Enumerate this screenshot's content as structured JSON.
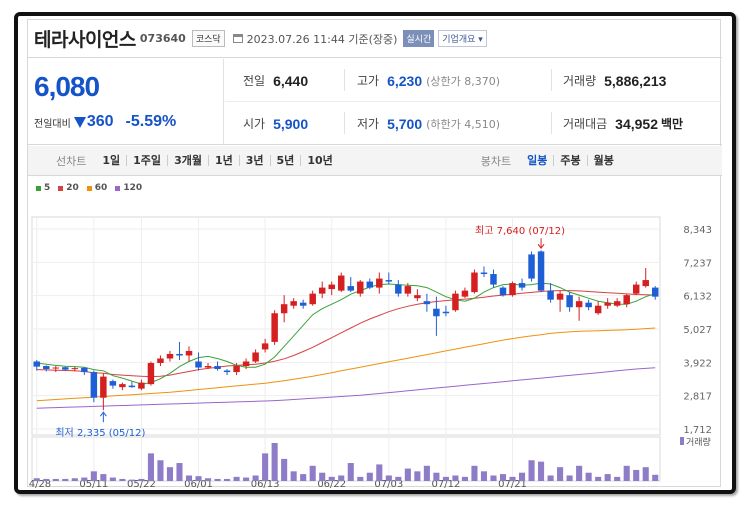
{
  "header": {
    "name": "테라사이언스",
    "code": "073640",
    "market": "코스닥",
    "datetime": "2023.07.26 11:44 기준(장중)",
    "realtime_label": "실시간",
    "corp_label": "기업개요"
  },
  "summary": {
    "price": "6,080",
    "change_label": "전일대비",
    "change_amount": "360",
    "change_pct": "-5.59%",
    "prev_close_label": "전일",
    "prev_close": "6,440",
    "high_label": "고가",
    "high": "6,230",
    "upper_limit_label": "(상한가 8,370)",
    "volume_label": "거래량",
    "volume": "5,886,213",
    "open_label": "시가",
    "open": "5,900",
    "low_label": "저가",
    "low": "5,700",
    "lower_limit_label": "(하한가 4,510)",
    "amount_label": "거래대금",
    "amount": "34,952",
    "amount_unit": "백만"
  },
  "line_chart": {
    "label": "선차트",
    "periods": [
      "1일",
      "1주일",
      "3개월",
      "1년",
      "3년",
      "5년",
      "10년"
    ]
  },
  "candle_chart": {
    "label": "봉차트",
    "periods": [
      "일봉",
      "주봉",
      "월봉"
    ],
    "active": "일봉"
  },
  "colors": {
    "up": "#d42020",
    "down": "#1f5fd6",
    "ma5": "#3aa13a",
    "ma20": "#d94040",
    "ma60": "#f0900f",
    "ma120": "#9966cc",
    "volume": "#8e7cc8"
  },
  "chart_data": {
    "type": "candlestick",
    "legend": [
      {
        "name": "5",
        "color": "#3aa13a"
      },
      {
        "name": "20",
        "color": "#d94040"
      },
      {
        "name": "60",
        "color": "#f0900f"
      },
      {
        "name": "120",
        "color": "#9966cc"
      }
    ],
    "y_ticks": [
      "8,343",
      "7,237",
      "6,132",
      "5,027",
      "3,922",
      "2,817",
      "1,712"
    ],
    "ylim": [
      1712,
      8343
    ],
    "x_ticks": [
      "04/28",
      "05/11",
      "05/22",
      "06/01",
      "06/13",
      "06/22",
      "07/03",
      "07/12",
      "07/21"
    ],
    "x_tick_index": [
      0,
      6,
      11,
      17,
      24,
      31,
      37,
      43,
      50
    ],
    "high_annotation": "최고 7,640 (07/12)",
    "low_annotation": "최저 2,335 (05/12)",
    "volume_label": "거래량",
    "candles": [
      [
        3950,
        4000,
        3650,
        3780
      ],
      [
        3800,
        3820,
        3620,
        3700
      ],
      [
        3720,
        3800,
        3600,
        3750
      ],
      [
        3760,
        3780,
        3650,
        3680
      ],
      [
        3700,
        3780,
        3620,
        3730
      ],
      [
        3740,
        3760,
        3500,
        3600
      ],
      [
        3600,
        3650,
        2600,
        2750
      ],
      [
        2750,
        3550,
        2335,
        3450
      ],
      [
        3300,
        3350,
        3050,
        3150
      ],
      [
        3100,
        3250,
        3000,
        3200
      ],
      [
        3150,
        3280,
        3080,
        3100
      ],
      [
        3050,
        3350,
        3000,
        3250
      ],
      [
        3200,
        3950,
        3150,
        3900
      ],
      [
        3900,
        4150,
        3800,
        4050
      ],
      [
        4050,
        4300,
        3950,
        4200
      ],
      [
        4200,
        4600,
        4000,
        4150
      ],
      [
        4150,
        4450,
        3950,
        4300
      ],
      [
        3950,
        4250,
        3650,
        3750
      ],
      [
        3750,
        3900,
        3700,
        3800
      ],
      [
        3800,
        3950,
        3650,
        3700
      ],
      [
        3650,
        3700,
        3500,
        3600
      ],
      [
        3600,
        3900,
        3500,
        3800
      ],
      [
        3800,
        4050,
        3700,
        3950
      ],
      [
        3950,
        4350,
        3900,
        4250
      ],
      [
        4350,
        4700,
        4250,
        4550
      ],
      [
        4600,
        5650,
        4500,
        5550
      ],
      [
        5550,
        6150,
        5250,
        5850
      ],
      [
        5800,
        6050,
        5700,
        5950
      ],
      [
        5900,
        6000,
        5700,
        5800
      ],
      [
        5850,
        6300,
        5800,
        6200
      ],
      [
        6200,
        6600,
        6050,
        6400
      ],
      [
        6350,
        6600,
        6150,
        6500
      ],
      [
        6300,
        6900,
        6250,
        6800
      ],
      [
        6450,
        6750,
        6250,
        6300
      ],
      [
        6200,
        6650,
        6100,
        6600
      ],
      [
        6600,
        6700,
        6350,
        6400
      ],
      [
        6400,
        6900,
        6200,
        6700
      ],
      [
        6650,
        6900,
        6500,
        6600
      ],
      [
        6500,
        6650,
        6100,
        6200
      ],
      [
        6200,
        6550,
        6100,
        6450
      ],
      [
        6050,
        6350,
        5950,
        6150
      ],
      [
        5950,
        6200,
        5600,
        5850
      ],
      [
        5700,
        6100,
        4800,
        5450
      ],
      [
        5600,
        5800,
        5450,
        5550
      ],
      [
        5650,
        6300,
        5600,
        6200
      ],
      [
        6100,
        6400,
        6050,
        6300
      ],
      [
        6250,
        7000,
        6200,
        6900
      ],
      [
        6900,
        7100,
        6750,
        6850
      ],
      [
        6850,
        7000,
        6400,
        6500
      ],
      [
        6400,
        6450,
        6100,
        6150
      ],
      [
        6150,
        6600,
        6100,
        6550
      ],
      [
        6550,
        6700,
        6300,
        6400
      ],
      [
        7500,
        7600,
        6600,
        6700
      ],
      [
        7600,
        7640,
        6250,
        6300
      ],
      [
        6300,
        6550,
        5900,
        6000
      ],
      [
        6000,
        6300,
        5600,
        6200
      ],
      [
        6150,
        6250,
        5600,
        5750
      ],
      [
        5750,
        6100,
        5300,
        5950
      ],
      [
        5900,
        6000,
        5650,
        5750
      ],
      [
        5550,
        5950,
        5500,
        5800
      ],
      [
        5800,
        6050,
        5700,
        5900
      ],
      [
        5800,
        6050,
        5750,
        5950
      ],
      [
        5850,
        6200,
        5750,
        6150
      ],
      [
        6200,
        6600,
        6150,
        6500
      ],
      [
        6450,
        7050,
        6400,
        6650
      ],
      [
        6400,
        6450,
        6000,
        6100
      ]
    ],
    "ma": {
      "5": [
        3900,
        3860,
        3820,
        3790,
        3780,
        3760,
        3680,
        3640,
        3480,
        3400,
        3300,
        3200,
        3250,
        3380,
        3560,
        3780,
        3950,
        4080,
        4120,
        4050,
        3950,
        3820,
        3760,
        3760,
        3860,
        4100,
        4450,
        4800,
        5150,
        5500,
        5700,
        5850,
        6000,
        6180,
        6300,
        6420,
        6500,
        6520,
        6500,
        6480,
        6460,
        6400,
        6250,
        6100,
        6000,
        5950,
        6050,
        6250,
        6400,
        6500,
        6520,
        6480,
        6500,
        6550,
        6520,
        6400,
        6250,
        6150,
        6050,
        5950,
        5900,
        5850,
        5850,
        5950,
        6100,
        6200
      ],
      "20": [
        3680,
        3670,
        3660,
        3650,
        3640,
        3620,
        3580,
        3560,
        3520,
        3500,
        3480,
        3460,
        3450,
        3460,
        3500,
        3560,
        3620,
        3680,
        3720,
        3760,
        3800,
        3820,
        3840,
        3860,
        3900,
        3960,
        4040,
        4150,
        4280,
        4420,
        4580,
        4740,
        4900,
        5060,
        5220,
        5360,
        5480,
        5600,
        5700,
        5780,
        5850,
        5900,
        5940,
        5970,
        6000,
        6020,
        6050,
        6080,
        6120,
        6150,
        6180,
        6210,
        6240,
        6270,
        6290,
        6300,
        6300,
        6290,
        6270,
        6250,
        6230,
        6210,
        6190,
        6170,
        6160,
        6150
      ],
      "60": [
        2650,
        2670,
        2690,
        2710,
        2730,
        2750,
        2770,
        2790,
        2810,
        2830,
        2850,
        2870,
        2890,
        2910,
        2930,
        2960,
        2990,
        3020,
        3050,
        3080,
        3110,
        3140,
        3170,
        3200,
        3230,
        3270,
        3310,
        3360,
        3410,
        3460,
        3520,
        3580,
        3640,
        3700,
        3760,
        3820,
        3880,
        3940,
        4000,
        4060,
        4120,
        4180,
        4240,
        4300,
        4360,
        4420,
        4480,
        4540,
        4600,
        4660,
        4710,
        4760,
        4800,
        4840,
        4880,
        4910,
        4930,
        4950,
        4960,
        4970,
        4980,
        4990,
        5000,
        5020,
        5040,
        5060
      ],
      "120": [
        2400,
        2410,
        2420,
        2430,
        2440,
        2450,
        2460,
        2470,
        2480,
        2490,
        2500,
        2510,
        2520,
        2530,
        2540,
        2550,
        2560,
        2570,
        2580,
        2590,
        2600,
        2610,
        2620,
        2630,
        2640,
        2655,
        2670,
        2690,
        2710,
        2730,
        2750,
        2770,
        2790,
        2810,
        2830,
        2860,
        2890,
        2920,
        2950,
        2980,
        3010,
        3040,
        3070,
        3100,
        3130,
        3160,
        3190,
        3220,
        3250,
        3280,
        3310,
        3340,
        3370,
        3400,
        3430,
        3460,
        3490,
        3520,
        3550,
        3580,
        3610,
        3640,
        3670,
        3700,
        3720,
        3740
      ]
    },
    "volume": [
      4,
      3,
      3,
      3,
      4,
      5,
      14,
      10,
      5,
      3,
      2,
      3,
      40,
      30,
      20,
      26,
      8,
      7,
      4,
      3,
      3,
      6,
      5,
      8,
      40,
      55,
      32,
      14,
      10,
      22,
      12,
      6,
      8,
      26,
      6,
      12,
      24,
      8,
      6,
      18,
      14,
      22,
      12,
      6,
      8,
      6,
      22,
      14,
      8,
      10,
      6,
      12,
      30,
      28,
      8,
      20,
      8,
      22,
      12,
      6,
      10,
      6,
      22,
      16,
      20,
      9
    ]
  }
}
